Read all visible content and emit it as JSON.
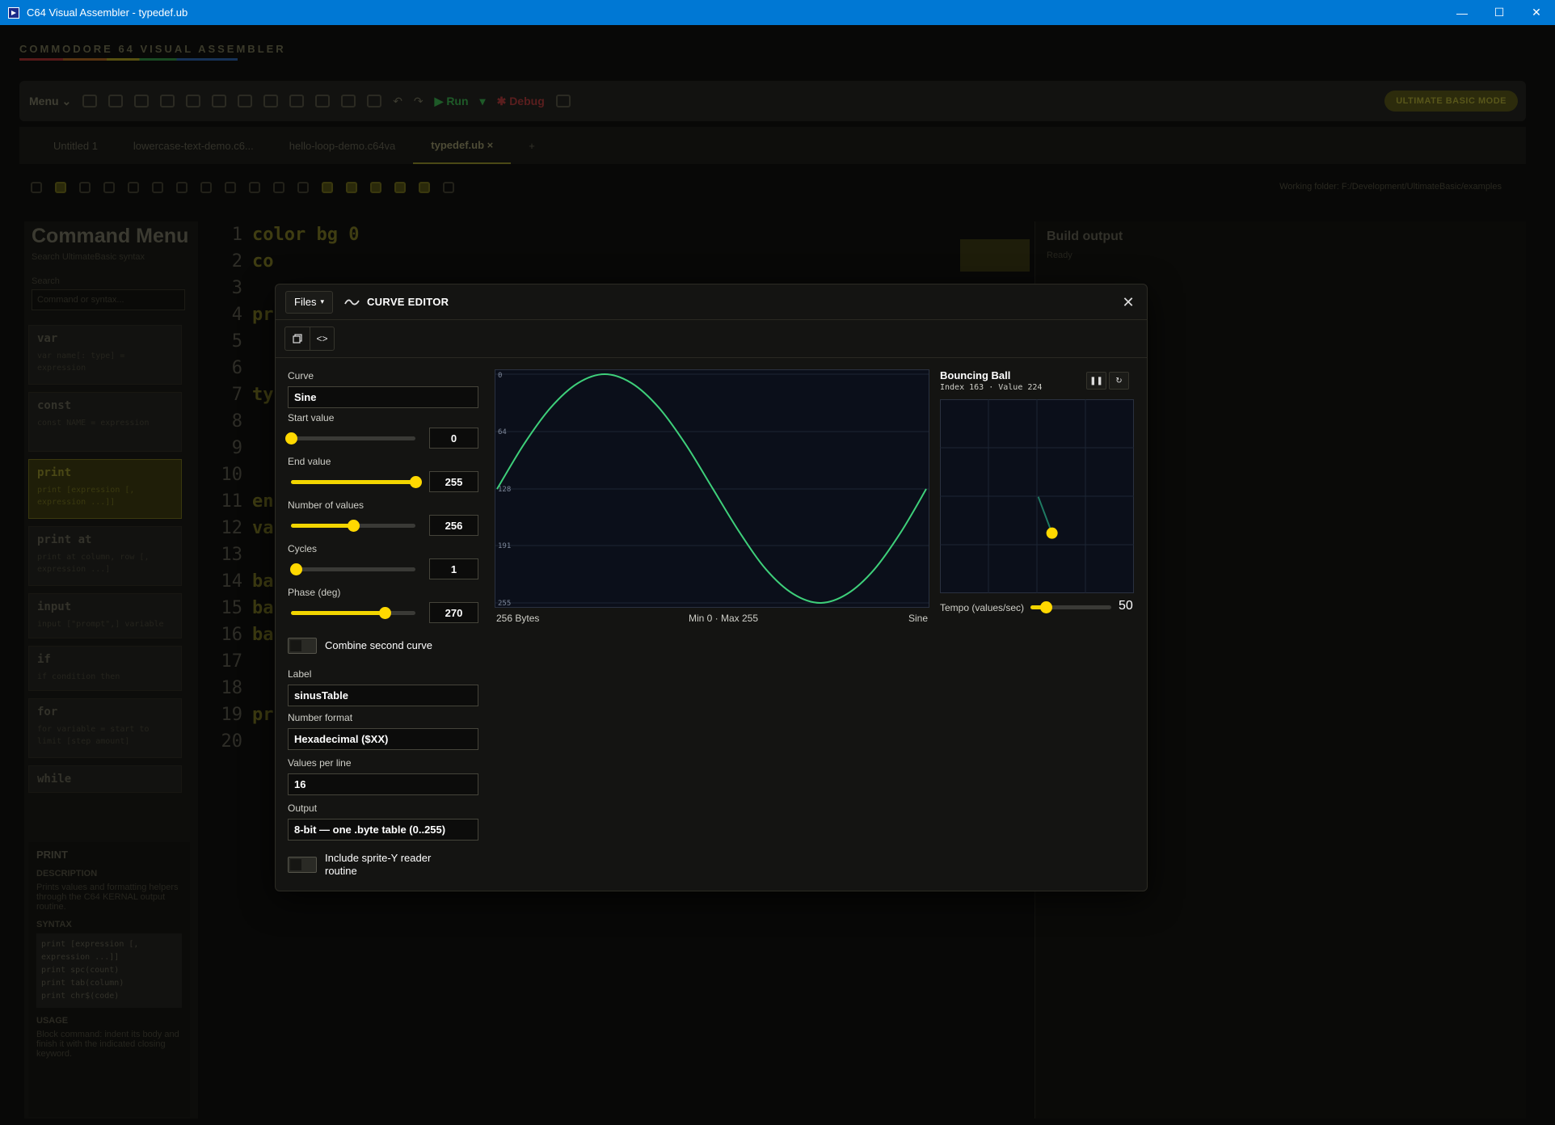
{
  "window": {
    "title": "C64 Visual Assembler - typedef.ub"
  },
  "brand": {
    "name": "COMMODORE 64 VISUAL ASSEMBLER"
  },
  "toolbar": {
    "menu_label": "Menu",
    "run_label": "Run",
    "debug_label": "Debug",
    "mode_label": "ULTIMATE BASIC MODE"
  },
  "tabs": [
    {
      "label": "Untitled 1"
    },
    {
      "label": "lowercase-text-demo.c6..."
    },
    {
      "label": "hello-loop-demo.c64va"
    },
    {
      "label": "typedef.ub ×"
    },
    {
      "label": "+"
    }
  ],
  "subtoolbar": {
    "working_folder": "Working folder: F:/Development/UltimateBasic/examples"
  },
  "command_menu": {
    "title": "Command Menu",
    "subtitle": "Search UltimateBasic syntax",
    "search_label": "Search",
    "search_placeholder": "Command or syntax...",
    "items": [
      {
        "name": "var",
        "syntax": "var name[: type] = expression"
      },
      {
        "name": "const",
        "syntax": "const NAME = expression"
      },
      {
        "name": "print",
        "syntax": "print [expression [, expression ...]]"
      },
      {
        "name": "print at",
        "syntax": "print at column, row [, expression ...]"
      },
      {
        "name": "input",
        "syntax": "input [\"prompt\",] variable"
      },
      {
        "name": "if",
        "syntax": "if condition then"
      },
      {
        "name": "for",
        "syntax": "for variable = start to limit [step amount]"
      },
      {
        "name": "while",
        "syntax": ""
      }
    ],
    "detail": {
      "heading": "PRINT",
      "description_label": "DESCRIPTION",
      "description": "Prints values and formatting helpers through the C64 KERNAL output routine.",
      "syntax_label": "SYNTAX",
      "syntax_lines": [
        "print [expression [,",
        "expression ...]]",
        "print spc(count)",
        "print tab(column)",
        "print chr$(code)"
      ],
      "usage_label": "USAGE",
      "usage": "Block command: indent its body and finish it with the indicated closing keyword."
    }
  },
  "editor": {
    "line_numbers": [
      "1",
      "2",
      "3",
      "4",
      "5",
      "6",
      "7",
      "8",
      "9",
      "10",
      "11",
      "12",
      "13",
      "14",
      "15",
      "16",
      "17",
      "18",
      "19",
      "20"
    ],
    "lines": [
      "color bg 0",
      "co",
      "",
      "pr",
      "",
      "",
      "ty",
      "",
      "",
      "",
      "en",
      "va",
      "",
      "ba",
      "ba",
      "ba",
      "",
      "",
      "pr",
      ""
    ]
  },
  "right_panel": {
    "title": "Build output",
    "subtitle": "Ready"
  },
  "modal": {
    "files_label": "Files",
    "title": "CURVE EDITOR",
    "curve": {
      "label": "Curve",
      "value": "Sine"
    },
    "start_value": {
      "label": "Start value",
      "value": "0",
      "slider_fraction": 0.0
    },
    "end_value": {
      "label": "End value",
      "value": "255",
      "slider_fraction": 1.0
    },
    "num_values": {
      "label": "Number of values",
      "value": "256",
      "slider_fraction": 0.5
    },
    "cycles": {
      "label": "Cycles",
      "value": "1",
      "slider_fraction": 0.04
    },
    "phase": {
      "label": "Phase (deg)",
      "value": "270",
      "slider_fraction": 0.75
    },
    "combine": {
      "label": "Combine second curve",
      "on": false
    },
    "label_field": {
      "label": "Label",
      "value": "sinusTable"
    },
    "number_format": {
      "label": "Number format",
      "value": "Hexadecimal ($XX)"
    },
    "values_per_line": {
      "label": "Values per line",
      "value": "16"
    },
    "output": {
      "label": "Output",
      "value": "8-bit — one .byte table (0..255)"
    },
    "sprite_reader": {
      "label": "Include sprite-Y reader routine",
      "on": false
    },
    "footer": {
      "bytes": "256 Bytes",
      "minmax": "Min 0 · Max 255",
      "type": "Sine"
    },
    "ball": {
      "title": "Bouncing Ball",
      "info": "Index 163 · Value 224",
      "index": 163,
      "value": 224
    },
    "tempo": {
      "label": "Tempo (values/sec)",
      "value": "50",
      "slider_fraction": 0.19
    }
  },
  "colors": {
    "accent": "#ffd800",
    "curve": "#3ecf7a",
    "chart_bg": "#0b0f1a",
    "grid": "#1d2534"
  },
  "chart_data": {
    "type": "line",
    "title": "",
    "xlabel": "",
    "ylabel": "",
    "y_ticks": [
      "0",
      "64",
      "128",
      "191",
      "255"
    ],
    "ylim": [
      0,
      255
    ],
    "y_inverted": true,
    "xlim": [
      0,
      255
    ],
    "series": [
      {
        "x": [
          0,
          16,
          32,
          48,
          64,
          80,
          96,
          112,
          128,
          144,
          160,
          176,
          192,
          208,
          224,
          240,
          255
        ],
        "values": [
          128,
          78,
          37,
          10,
          0,
          10,
          37,
          78,
          127,
          176,
          218,
          245,
          255,
          245,
          218,
          176,
          128
        ]
      }
    ]
  }
}
